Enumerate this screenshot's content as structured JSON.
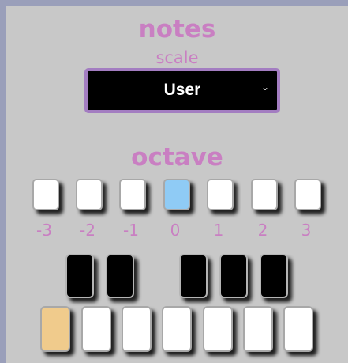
{
  "notes": {
    "title": "notes",
    "scale_label": "scale",
    "scale_value": "User",
    "chevron": "chevron-down-icon"
  },
  "octave": {
    "title": "octave",
    "options": [
      "-3",
      "-2",
      "-1",
      "0",
      "1",
      "2",
      "3"
    ],
    "selected": "0"
  },
  "keyboard": {
    "black_keys": 5,
    "white_keys": 7,
    "selected_white_index": 0
  },
  "colors": {
    "accent": "#c97fc2",
    "select_border": "#a37dc1",
    "octave_active": "#8fcbf5",
    "key_active": "#f0cb8c",
    "panel": "#c8c8c8",
    "frame": "#9a9fba"
  }
}
